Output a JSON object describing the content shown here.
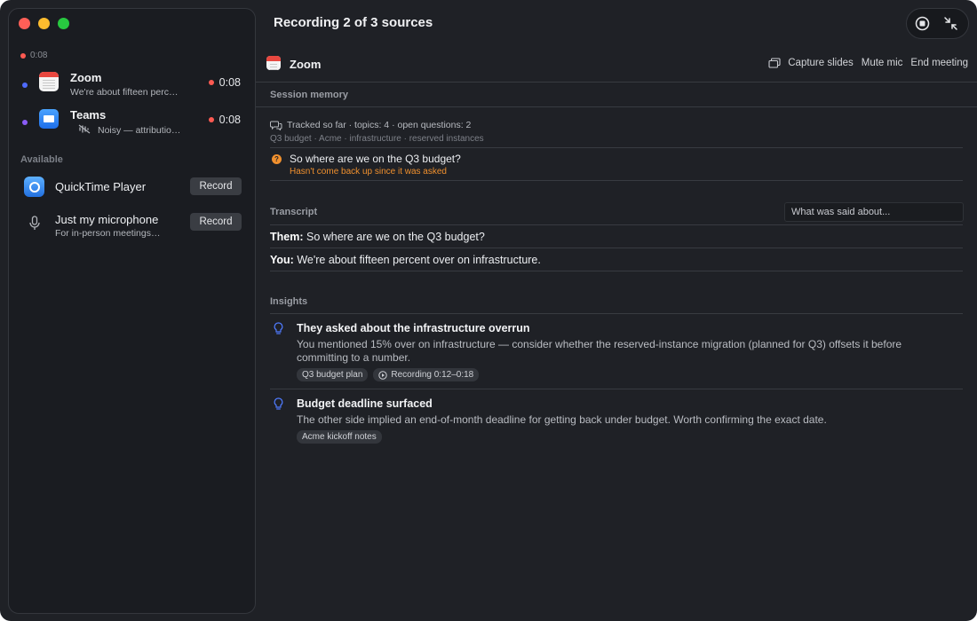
{
  "sidebar": {
    "elapsed": "0:08",
    "sources": [
      {
        "name": "Zoom",
        "subtitle": "We're about fifteen perc…",
        "timer": "0:08",
        "dot_color": "#4f6bff",
        "icon": "calendar-icon"
      },
      {
        "name": "Teams",
        "subtitle": "Noisy — attributio…",
        "timer": "0:08",
        "dot_color": "#8b5cf6",
        "icon": "mail-icon"
      }
    ],
    "available_label": "Available",
    "available": [
      {
        "name": "QuickTime Player",
        "subtitle": "",
        "button": "Record",
        "icon": "quicktime-icon"
      },
      {
        "name": "Just my microphone",
        "subtitle": "For in-person meetings…",
        "button": "Record",
        "icon": "microphone-icon"
      }
    ]
  },
  "main": {
    "title": "Recording 2 of 3 sources",
    "meeting": {
      "name": "Zoom",
      "actions": {
        "capture": "Capture slides",
        "mute": "Mute mic",
        "end": "End meeting"
      }
    },
    "session_memory": {
      "heading": "Session memory",
      "tracked": "Tracked so far · topics: 4 · open questions: 2",
      "topics": "Q3 budget · Acme · infrastructure · reserved instances",
      "question": "So where are we on the Q3 budget?",
      "question_note": "Hasn't come back up since it was asked"
    },
    "transcript": {
      "heading": "Transcript",
      "search_placeholder": "What was said about...",
      "lines": [
        {
          "speaker": "Them:",
          "text": "So where are we on the Q3 budget?"
        },
        {
          "speaker": "You:",
          "text": "We're about fifteen percent over on infrastructure."
        }
      ]
    },
    "insights": {
      "heading": "Insights",
      "items": [
        {
          "title": "They asked about the infrastructure overrun",
          "body1": "You mentioned 15% over on infrastructure — consider whether the reserved-instance migration (planned for Q3) offsets it before",
          "body2": "committing to a number.",
          "chips": [
            "Q3 budget plan",
            "Recording 0:12–0:18"
          ]
        },
        {
          "title": "Budget deadline surfaced",
          "body1": "The other side implied an end-of-month deadline for getting back under budget. Worth confirming the exact date.",
          "chips": [
            "Acme kickoff notes"
          ]
        }
      ]
    }
  },
  "colors": {
    "recording_red": "#ff5a52",
    "warning_orange": "#f0902e",
    "insight_blue": "#4f7bff"
  }
}
